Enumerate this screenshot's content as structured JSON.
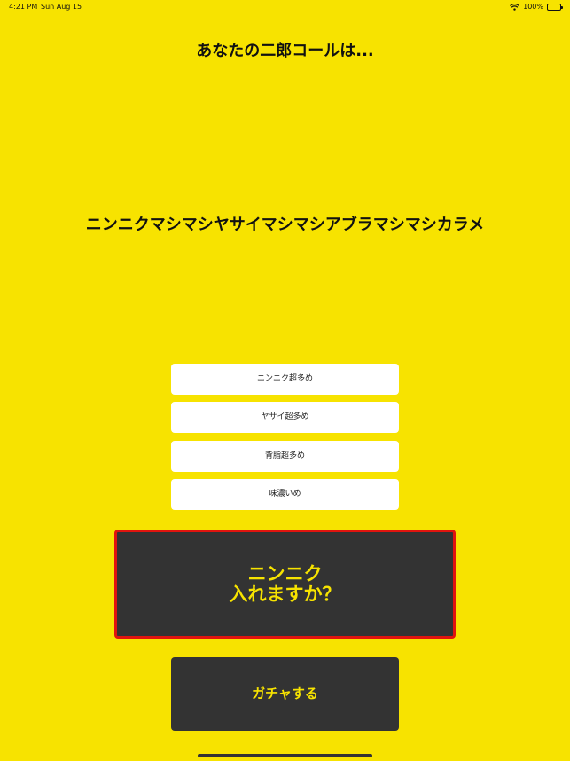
{
  "status_bar": {
    "time": "4:21 PM",
    "date": "Sun Aug 15",
    "battery_percent": "100%",
    "battery_level": 1.0
  },
  "header": {
    "title": "あなたの二郎コールは..."
  },
  "result": {
    "call_text": "ニンニクマシマシヤサイマシマシアブラマシマシカラメ"
  },
  "options": [
    {
      "label": "ニンニク超多め"
    },
    {
      "label": "ヤサイ超多め"
    },
    {
      "label": "背脂超多め"
    },
    {
      "label": "味濃いめ"
    }
  ],
  "question": {
    "line1": "ニンニク",
    "line2": "入れますか？"
  },
  "gacha": {
    "label": "ガチャする"
  },
  "colors": {
    "background": "#F7E300",
    "panel": "#333333",
    "accent_text": "#F7E300",
    "highlight_border": "#E0140F",
    "option_background": "#FFFFFF"
  }
}
